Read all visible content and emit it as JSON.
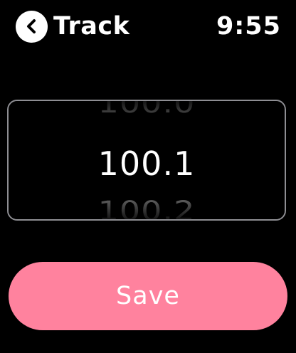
{
  "header": {
    "title": "Track",
    "time": "9:55",
    "back_icon": "chevron-left-icon"
  },
  "picker": {
    "previous_value": "100.0",
    "selected_value": "100.1",
    "next_value": "100.2"
  },
  "actions": {
    "save_label": "Save"
  },
  "colors": {
    "background": "#000000",
    "accent": "#ff829e",
    "picker_border": "#8e8e93",
    "text": "#ffffff"
  }
}
